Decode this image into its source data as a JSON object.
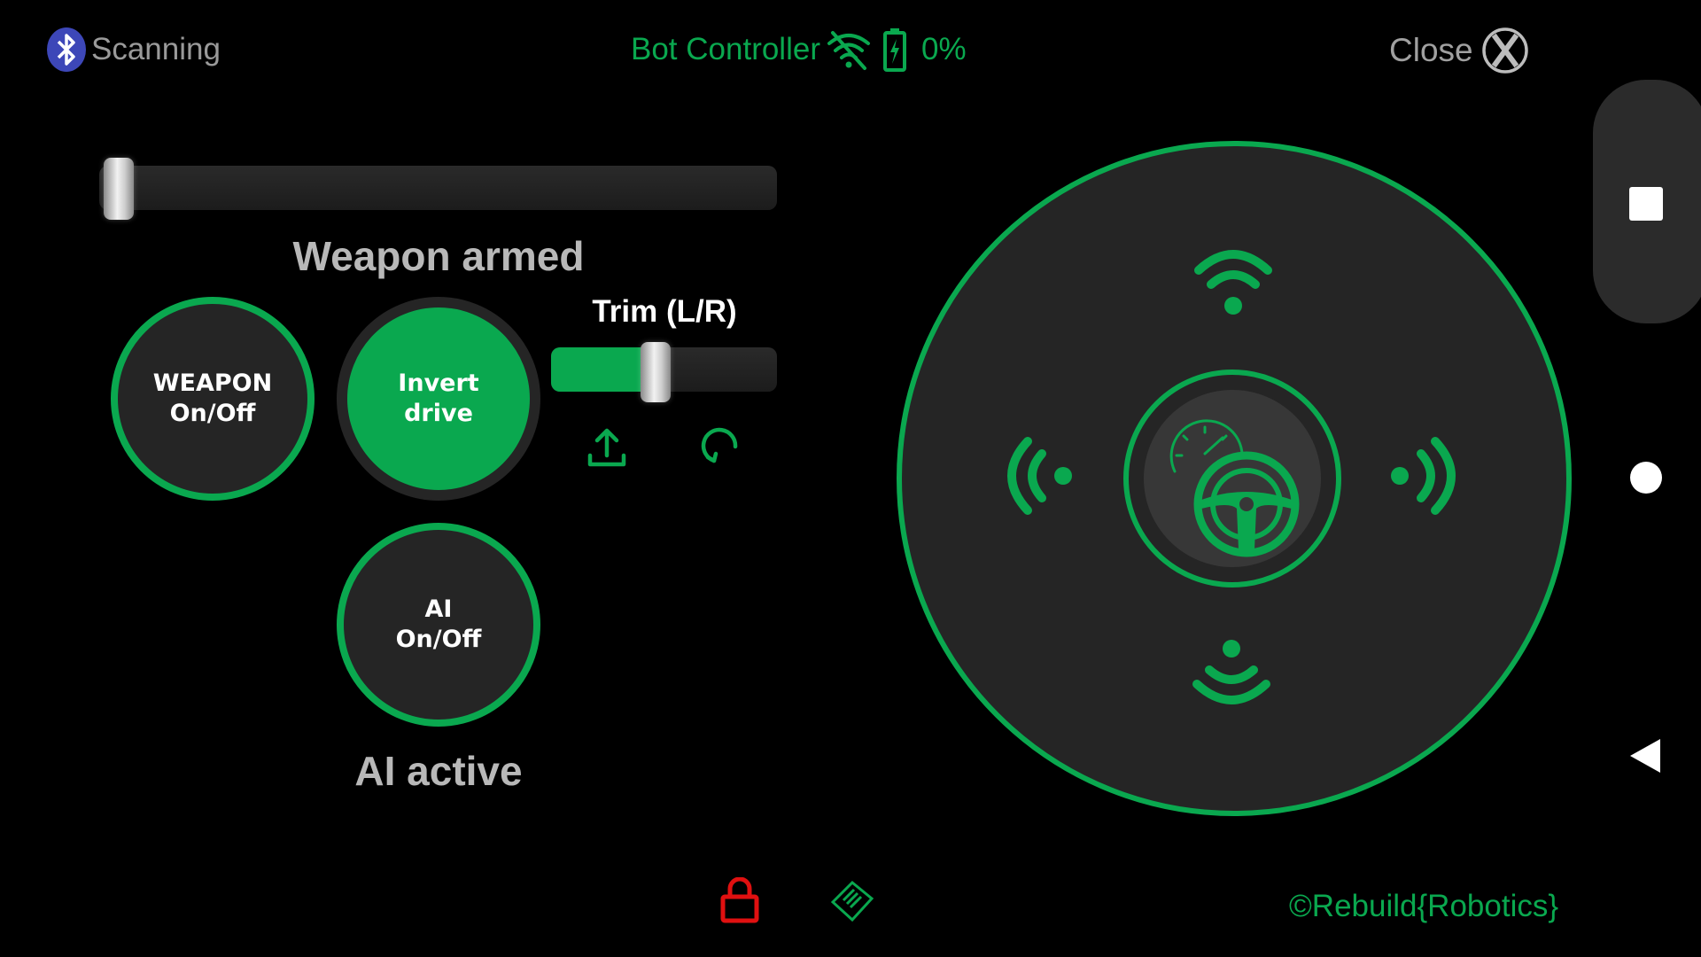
{
  "header": {
    "bluetooth_status": "Scanning",
    "title": "Bot Controller",
    "battery_percent": "0%",
    "close_label": "Close"
  },
  "weapon": {
    "slider_value": 0,
    "status": "Weapon armed",
    "button_line1": "WEAPON",
    "button_line2": "On/Off"
  },
  "drive": {
    "invert_line1": "Invert",
    "invert_line2": "drive"
  },
  "trim": {
    "label": "Trim (L/R)",
    "value": 0.5
  },
  "ai": {
    "button_line1": "AI",
    "button_line2": "On/Off",
    "status": "AI active"
  },
  "footer": {
    "copyright": "©Rebuild{Robotics}"
  },
  "colors": {
    "accent": "#0aa84f",
    "lock": "#e01010",
    "nav_bg": "#2b2b2b"
  },
  "icons": [
    "bluetooth-icon",
    "wifi-off-icon",
    "battery-charging-icon",
    "close-x-icon",
    "upload-icon",
    "reset-icon",
    "signal-forward-icon",
    "signal-left-icon",
    "signal-right-icon",
    "signal-back-icon",
    "speedometer-icon",
    "steering-wheel-icon",
    "lock-icon",
    "gamepad-icon"
  ]
}
